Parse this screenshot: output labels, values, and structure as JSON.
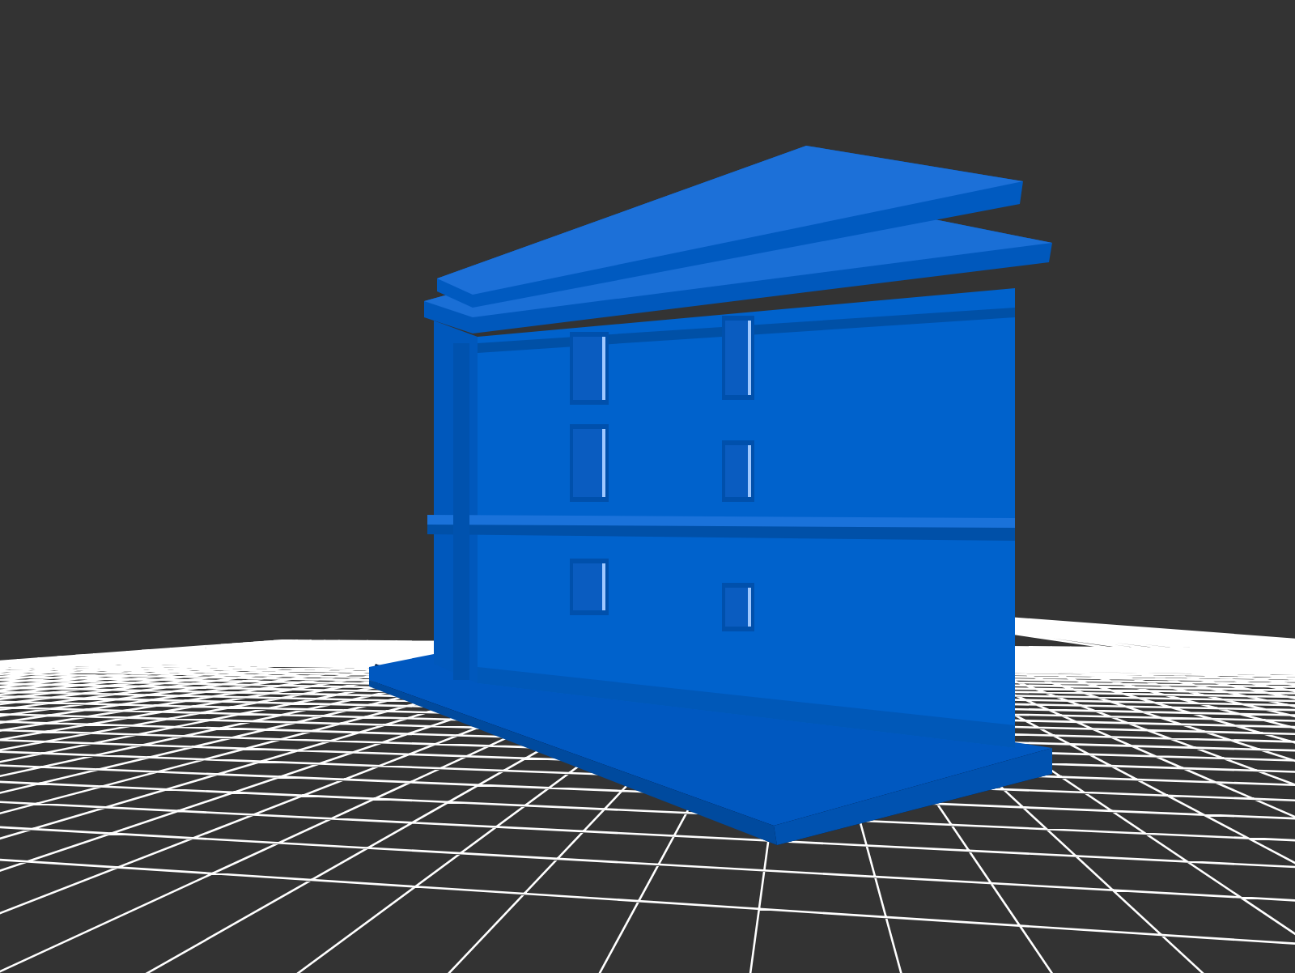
{
  "viewport": {
    "grid": true
  }
}
